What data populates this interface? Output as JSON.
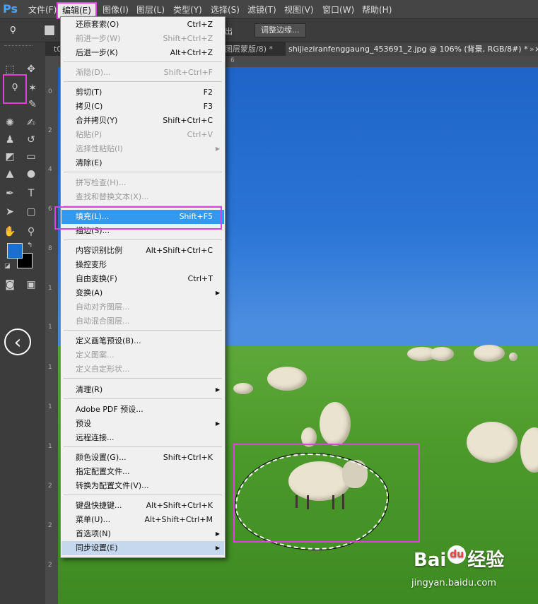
{
  "app": {
    "logo": "Ps"
  },
  "menubar": {
    "items": [
      "文件(F)",
      "编辑(E)",
      "图像(I)",
      "图层(L)",
      "类型(Y)",
      "选择(S)",
      "滤镜(T)",
      "视图(V)",
      "窗口(W)",
      "帮助(H)"
    ]
  },
  "options": {
    "output_label": "出",
    "refine_edge": "调整边缘..."
  },
  "tabs": {
    "left_partial": "t0",
    "layer_mask": "图层蒙版/8) *",
    "active": "shijieziranfenggaung_453691_2.jpg @ 106% (背景, RGB/8#) *",
    "close": "×",
    "more": "»"
  },
  "ruler": {
    "left": [
      "0",
      "2",
      "4",
      "6",
      "8",
      "1",
      "1",
      "1",
      "1",
      "1",
      "2",
      "2",
      "2"
    ],
    "top": [
      "6"
    ]
  },
  "edit_menu": {
    "items": [
      {
        "label": "还原套索(O)",
        "shortcut": "Ctrl+Z",
        "disabled": false
      },
      {
        "label": "前进一步(W)",
        "shortcut": "Shift+Ctrl+Z",
        "disabled": true
      },
      {
        "label": "后退一步(K)",
        "shortcut": "Alt+Ctrl+Z",
        "disabled": false
      },
      {
        "label": "渐隐(D)...",
        "shortcut": "Shift+Ctrl+F",
        "disabled": true
      },
      {
        "label": "剪切(T)",
        "shortcut": "F2",
        "disabled": false
      },
      {
        "label": "拷贝(C)",
        "shortcut": "F3",
        "disabled": false
      },
      {
        "label": "合并拷贝(Y)",
        "shortcut": "Shift+Ctrl+C",
        "disabled": false
      },
      {
        "label": "粘贴(P)",
        "shortcut": "Ctrl+V",
        "disabled": true
      },
      {
        "label": "选择性粘贴(I)",
        "shortcut": "",
        "disabled": true,
        "submenu": true
      },
      {
        "label": "清除(E)",
        "shortcut": "",
        "disabled": false
      },
      {
        "label": "拼写检查(H)...",
        "shortcut": "",
        "disabled": true
      },
      {
        "label": "查找和替换文本(X)...",
        "shortcut": "",
        "disabled": true
      },
      {
        "label": "填充(L)...",
        "shortcut": "Shift+F5",
        "disabled": false,
        "selected": true
      },
      {
        "label": "描边(S)...",
        "shortcut": "",
        "disabled": false
      },
      {
        "label": "内容识别比例",
        "shortcut": "Alt+Shift+Ctrl+C",
        "disabled": false
      },
      {
        "label": "操控变形",
        "shortcut": "",
        "disabled": false
      },
      {
        "label": "自由变换(F)",
        "shortcut": "Ctrl+T",
        "disabled": false
      },
      {
        "label": "变换(A)",
        "shortcut": "",
        "disabled": false,
        "submenu": true
      },
      {
        "label": "自动对齐图层...",
        "shortcut": "",
        "disabled": true
      },
      {
        "label": "自动混合图层...",
        "shortcut": "",
        "disabled": true
      },
      {
        "label": "定义画笔预设(B)...",
        "shortcut": "",
        "disabled": false
      },
      {
        "label": "定义图案...",
        "shortcut": "",
        "disabled": true
      },
      {
        "label": "定义自定形状...",
        "shortcut": "",
        "disabled": true
      },
      {
        "label": "清理(R)",
        "shortcut": "",
        "disabled": false,
        "submenu": true
      },
      {
        "label": "Adobe PDF 预设...",
        "shortcut": "",
        "disabled": false
      },
      {
        "label": "预设",
        "shortcut": "",
        "disabled": false,
        "submenu": true
      },
      {
        "label": "远程连接...",
        "shortcut": "",
        "disabled": false
      },
      {
        "label": "颜色设置(G)...",
        "shortcut": "Shift+Ctrl+K",
        "disabled": false
      },
      {
        "label": "指定配置文件...",
        "shortcut": "",
        "disabled": false
      },
      {
        "label": "转换为配置文件(V)...",
        "shortcut": "",
        "disabled": false
      },
      {
        "label": "键盘快捷键...",
        "shortcut": "Alt+Shift+Ctrl+K",
        "disabled": false
      },
      {
        "label": "菜单(U)...",
        "shortcut": "Alt+Shift+Ctrl+M",
        "disabled": false
      },
      {
        "label": "首选项(N)",
        "shortcut": "",
        "disabled": false,
        "submenu": true
      },
      {
        "label": "同步设置(E)",
        "shortcut": "",
        "disabled": false,
        "submenu": true,
        "hover": true
      }
    ]
  },
  "toolbar_colors": {
    "foreground": "#1a6fd0",
    "background": "#000000"
  },
  "watermark": {
    "brand": "Bai",
    "brand_du": "du",
    "brand_suffix": "经验",
    "url": "jingyan.baidu.com"
  },
  "nav": {
    "back_glyph": "‹"
  }
}
